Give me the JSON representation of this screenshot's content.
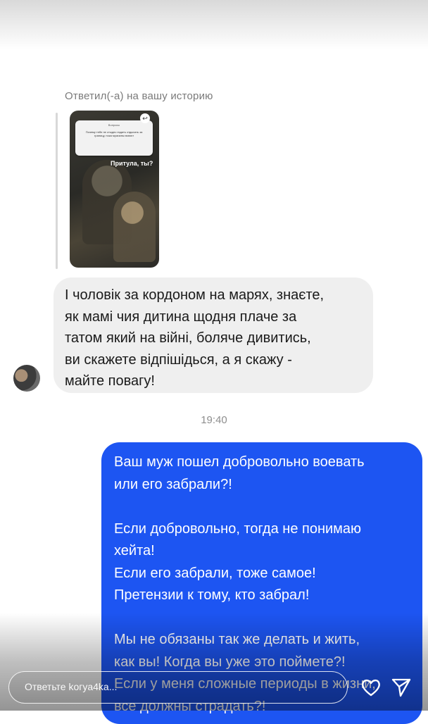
{
  "story_reply": {
    "label": "Ответил(-а) на вашу историю",
    "thumbnail": {
      "sticker_header": "Вопросы",
      "sticker_question": "Почему тебе не стыдно ездить отдыхать за границу, пока мужчины воюют",
      "answer_text": "Притула, ты?"
    }
  },
  "incoming_message": {
    "text": "І чоловік за кордоном на марях, знаєте,\nяк мамі чия дитина щодня плаче за\nтатом який на війні, боляче дивитись,\nви скажете відпішідься, а я скажу -\nмайте повагу!"
  },
  "timestamp": "19:40",
  "outgoing_message": {
    "text": "Ваш муж пошел добровольно воевать\nили его забрали?!\n\nЕсли добровольно, тогда не понимаю\nхейта!\nЕсли его забрали, тоже самое!\nПретензии к тому, кто забрал!\n\nМы не обязаны так же делать и жить,\nкак вы! Когда вы уже это поймете?!\nЕсли у меня сложные периоды в жизни,\nвсе должны страдать?!"
  },
  "composer": {
    "placeholder": "Ответьте koгya4ka..."
  },
  "icons": {
    "like": "heart-icon",
    "send": "send-icon"
  },
  "colors": {
    "outgoing_bubble": "#1d55f2",
    "incoming_bubble": "#efefef",
    "timestamp": "#8e8e8e"
  }
}
